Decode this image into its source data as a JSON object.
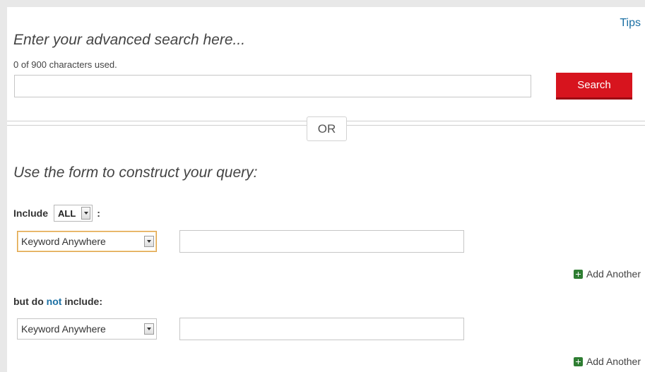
{
  "tips_label": "Tips",
  "advanced": {
    "heading": "Enter your advanced search here...",
    "char_count": "0 of 900 characters used.",
    "input_value": "",
    "search_label": "Search"
  },
  "or_label": "OR",
  "form": {
    "heading": "Use the form to construct your query:",
    "include_prefix": "Include",
    "include_mode": "ALL",
    "include_suffix": ":",
    "include_field": "Keyword Anywhere",
    "include_term": "",
    "add_another": "Add Another",
    "exclude_prefix": "but do",
    "exclude_not": "not",
    "exclude_suffix": "include:",
    "exclude_field": "Keyword Anywhere",
    "exclude_term": ""
  },
  "colors": {
    "accent_red": "#d7141e",
    "link_blue": "#1a6fa3",
    "add_green": "#2e7d32"
  }
}
